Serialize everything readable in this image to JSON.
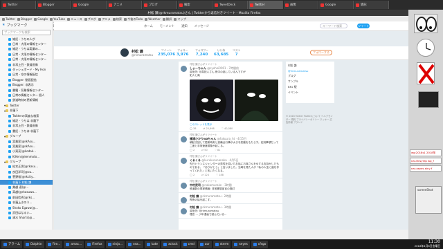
{
  "tabs": [
    {
      "label": "Twitter"
    },
    {
      "label": "Blogger"
    },
    {
      "label": "Google"
    },
    {
      "label": "アニメ"
    },
    {
      "label": "ブログ"
    },
    {
      "label": "検索"
    },
    {
      "label": "TweetDeck"
    },
    {
      "label": "Twitter"
    },
    {
      "label": "画像"
    },
    {
      "label": "Google"
    },
    {
      "label": "雑記"
    }
  ],
  "window_title": "村松 謙(@rkmuramatsu)さん | Twitterから返信付きツイート - Mozilla Firefox",
  "bookmarks_toolbar": [
    "Twitter",
    "Blogger",
    "Google",
    "YouTube",
    "ニュース",
    "ブログ",
    "アニメ",
    "検索",
    "今後のTodo",
    "Weather",
    "翻訳",
    "マップ"
  ],
  "url": "https://twitter.com/rkmuramatsu/with_replies",
  "search_placeholder": "検索",
  "sidebar": {
    "title": "ブックマーク",
    "search_placeholder": "ブックマークを検索",
    "items": [
      {
        "label": "雑記 - うちの人が",
        "folder": false,
        "selected": false
      },
      {
        "label": "日常 - 大阪の情報センター",
        "folder": false,
        "selected": false
      },
      {
        "label": "雑記 - うちは実業の...",
        "folder": false,
        "selected": false
      },
      {
        "label": "日常 - 大阪の情報センター",
        "folder": false,
        "selected": false
      },
      {
        "label": "日常 - 大阪の情報センター",
        "folder": false,
        "selected": false
      },
      {
        "label": "非常上目 - 鉄道画像",
        "folder": false,
        "selected": false
      },
      {
        "label": "ダッシュボード - My Hon",
        "folder": false,
        "selected": false
      },
      {
        "label": "日常 - 空の情報配信",
        "folder": false,
        "selected": false
      },
      {
        "label": "Blogger: 動画配信",
        "folder": false,
        "selected": false
      },
      {
        "label": "Blogger: 非表示",
        "folder": false,
        "selected": false
      },
      {
        "label": "書籍 - 気象情報センター",
        "folder": false,
        "selected": false
      },
      {
        "label": "日常の情報センター 個人",
        "folder": false,
        "selected": false
      },
      {
        "label": "鉄道時刻の更新情報",
        "folder": false,
        "selected": false
      },
      {
        "label": "Twitter",
        "folder": true,
        "selected": false
      },
      {
        "label": "非蓮下",
        "folder": true,
        "selected": false
      },
      {
        "label": "Twitterの高度な検索",
        "folder": false,
        "selected": false
      },
      {
        "label": "雑記 - うちは 非蓮下",
        "folder": false,
        "selected": false
      },
      {
        "label": "非常上目 - 鉄道画像",
        "folder": false,
        "selected": false
      },
      {
        "label": "書記 - うちは 非蓮下",
        "folder": false,
        "selected": false
      },
      {
        "label": "グループ",
        "folder": true,
        "selected": false
      },
      {
        "label": "実業家(@rkAsu...",
        "folder": false,
        "selected": false
      },
      {
        "label": "実業家(@rkAsu...",
        "folder": false,
        "selected": false
      },
      {
        "label": "小東亮(@kodak...",
        "folder": false,
        "selected": false
      },
      {
        "label": "K/Ken(@kenmoto...",
        "folder": false,
        "selected": false
      },
      {
        "label": "グループ",
        "folder": true,
        "selected": false
      },
      {
        "label": "松本正男(@rkasu...",
        "folder": false,
        "selected": false
      },
      {
        "label": "良田洋司(@ou...",
        "folder": false,
        "selected": false
      },
      {
        "label": "菅野裕(@rkcity...",
        "folder": false,
        "selected": false
      },
      {
        "label": "非蓮下 村松 謙",
        "folder": false,
        "selected": true
      },
      {
        "label": "美越 達(@...",
        "folder": false,
        "selected": false
      },
      {
        "label": "高越(@rkasuwa...",
        "folder": false,
        "selected": false
      },
      {
        "label": "前田信秀(@rks...",
        "folder": false,
        "selected": false
      },
      {
        "label": "非蓮上きのう...",
        "folder": false,
        "selected": false
      },
      {
        "label": "Shoko Egawa(@...",
        "folder": false,
        "selected": false
      },
      {
        "label": "武田はなるい...",
        "folder": false,
        "selected": false
      },
      {
        "label": "清水 Sharts(@...",
        "folder": false,
        "selected": false
      }
    ]
  },
  "twitter": {
    "nav": [
      "ホーム",
      "モーメント",
      "通知",
      "メッセージ"
    ],
    "search_placeholder": "キーワード検索",
    "tweet_button": "ツイート",
    "profile": {
      "name": "村松 謙",
      "handle": "@rkmuramatsu",
      "follow_label": "フォローする"
    },
    "stats": [
      {
        "label": "ツイート",
        "value": "235,076"
      },
      {
        "label": "フォロー",
        "value": "3,976"
      },
      {
        "label": "フォロワー",
        "value": "7,240"
      },
      {
        "label": "いいね",
        "value": "63,685"
      },
      {
        "label": "リスト",
        "value": "7"
      }
    ],
    "tweets": [
      {
        "context": "村松 謙さんがリツイート",
        "name": "しょーちゃん",
        "meta": "@syohei0001 · 7時間前",
        "text": "返信先: @真犯人さん 夜中の話しているんですが",
        "text2": "犯人と俺",
        "has_media": true,
        "link": "このスレッドを表示",
        "acts": [
          "38",
          "25,698",
          "40,080"
        ]
      },
      {
        "context": "村松 謙さんがリツイート",
        "name": "福浦ひかりwaちゃん",
        "meta": "@fukuura_ht · 4月5日",
        "text": "朝起き回して更新時刻と設備全行事が大きな変動をもたらす。定刻事項だって二度と非常速度現象が起こる。",
        "text2": "",
        "has_media": false,
        "link": "",
        "acts": [
          "2",
          "50",
          "81"
        ]
      },
      {
        "context": "村松 謙さんがリツイート",
        "name": "くるくる",
        "meta": "@kurukurunanoka · 4月5日",
        "text": "先日トランスジェンダーの男性を招いたお話にお母さんをゆする支持がしたものである、「ありがとう」と言いました。当時を見た人が「私の人生に道を作ってくれた」と言いたくなる。",
        "text2": "",
        "has_media": false,
        "link": "",
        "acts": [
          "2",
          "124",
          "188"
        ]
      },
      {
        "context": "村松 謙さんがリツイート",
        "name": "中村武司",
        "meta": "@nakamurake · 3時間",
        "text": "鉄道駅の車掌情報: 非常事態宣言の検討",
        "text2": "",
        "has_media": false,
        "link": "",
        "acts": [
          "",
          "",
          ""
        ]
      },
      {
        "context": "",
        "name": "村松 謙",
        "meta": "@rkmuramatsu · 2時間",
        "text": "昨夜の話を起こす。",
        "text2": "",
        "has_media": false,
        "link": "",
        "acts": [
          "",
          "",
          ""
        ]
      },
      {
        "context": "",
        "name": "村松 謙",
        "meta": "@rkmuramatsu · 3時間",
        "text": "返信先: @rkmuramatsu",
        "text2": "理念 ... 少年漫画で読んでいる...",
        "has_media": false,
        "link": "",
        "acts": [
          "",
          "",
          ""
        ]
      }
    ],
    "side": [
      {
        "text": "村松 謙",
        "link": false
      },
      {
        "text": "@rkmuramatsu",
        "link": true
      },
      {
        "text": "ブログ",
        "link": false
      },
      {
        "text": "サンプル",
        "link": false
      },
      {
        "text": "BR2 駅",
        "link": false
      },
      {
        "text": "イベント",
        "link": false
      }
    ],
    "footer": "© 2018 Twitter  Twitterについて  ヘルプセンター  規約  プライバシーポリシー  クッキー  広告情報  ブランド"
  },
  "taskbar": {
    "items": [
      "アラーム",
      "Dolphin",
      "Fire...",
      "amac...",
      "Firefox",
      "ninja...",
      "sea...",
      "kate",
      "xclock",
      "cmd",
      "acr",
      "xterm",
      "xeyes",
      "cfsgo"
    ],
    "time": "11:30",
    "date": "2018年4月6日金曜日"
  },
  "desktop_right": {
    "screenshot_label": "screenShot",
    "items": [
      "wg:2018s1 2018年",
      "nar-thisyrep wg_f",
      "nar-xeyes ainy f"
    ]
  },
  "colors": {
    "twitter_blue": "#1da1f2",
    "follow_orange": "#e8884a",
    "selection_blue": "#3d8fd6"
  }
}
